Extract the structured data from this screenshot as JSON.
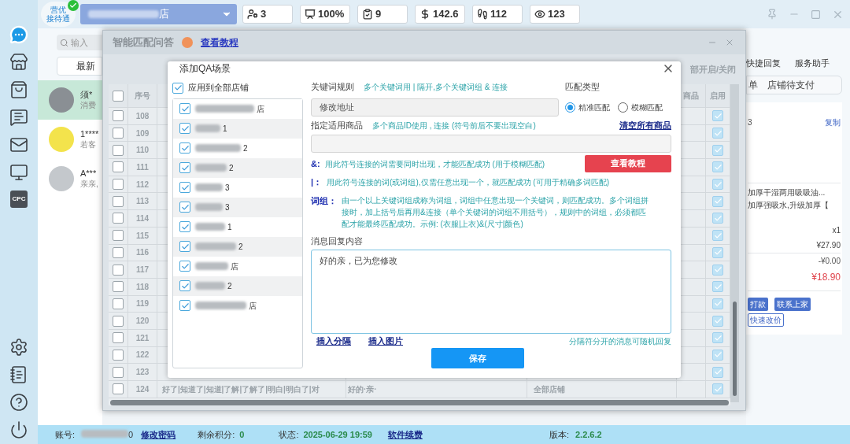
{
  "sidebar": {
    "items": [
      {
        "kind": "chat",
        "selected": true
      },
      {
        "kind": "store",
        "selected": false
      },
      {
        "kind": "bag",
        "selected": false
      },
      {
        "kind": "qa",
        "selected": false
      },
      {
        "kind": "mail",
        "selected": false
      },
      {
        "kind": "monitor",
        "selected": false
      },
      {
        "kind": "cpc",
        "label": "CPC",
        "selected": false
      }
    ],
    "bottom_items": [
      {
        "kind": "settings"
      },
      {
        "kind": "list"
      },
      {
        "kind": "help"
      },
      {
        "kind": "power"
      }
    ]
  },
  "topbar": {
    "logo_lines": [
      "营优",
      "接待通"
    ],
    "verified": true,
    "store_name": "店",
    "stats": [
      {
        "kind": "users",
        "value": "3"
      },
      {
        "kind": "chart",
        "value": "100%"
      },
      {
        "kind": "clipboard",
        "value": "9"
      },
      {
        "kind": "money",
        "value": "142.6"
      },
      {
        "kind": "footprints",
        "value": "112"
      },
      {
        "kind": "views",
        "value": "123"
      }
    ]
  },
  "chat_list": {
    "search_placeholder": "输入",
    "tab": "最新",
    "conversations": [
      {
        "name": "须*",
        "preview": "消费",
        "color": "#8a8f94",
        "selected": true
      },
      {
        "name": "1****",
        "preview": "若客",
        "color": "#f3e34c",
        "selected": false
      },
      {
        "name": "A***",
        "preview": "亲亲,",
        "color": "#c4c8cc",
        "selected": false
      }
    ]
  },
  "right_panel": {
    "tabs": [
      "快捷回复",
      "服务助手"
    ],
    "filters": [
      "单",
      "店铺待支付"
    ],
    "order_code": "3",
    "copy_link": "复制",
    "product_lines": [
      "加厚干湿两用吸吸油...",
      "加厚强吸水,升级加厚【"
    ],
    "quantity": "x1",
    "price": "¥27.90",
    "discount": "-¥0.00",
    "total": "¥18.90",
    "buttons": [
      "打款",
      "联系上家"
    ],
    "reprice_button": "快速改价"
  },
  "qa_window": {
    "title": "智能匹配问答",
    "tutorial_link": "查看教程",
    "toggle_all": "部开启/关闭",
    "columns": [
      "序号",
      "商品",
      "启用"
    ],
    "header_checked": false,
    "rows": [
      {
        "index": "108",
        "checked": false,
        "enabled": true
      },
      {
        "index": "109",
        "checked": false,
        "enabled": true
      },
      {
        "index": "110",
        "checked": false,
        "enabled": true
      },
      {
        "index": "111",
        "checked": false,
        "enabled": true
      },
      {
        "index": "112",
        "checked": false,
        "enabled": true
      },
      {
        "index": "113",
        "checked": false,
        "enabled": true
      },
      {
        "index": "114",
        "checked": false,
        "enabled": true
      },
      {
        "index": "115",
        "checked": false,
        "enabled": true
      },
      {
        "index": "116",
        "checked": false,
        "enabled": true
      },
      {
        "index": "117",
        "checked": false,
        "enabled": true
      },
      {
        "index": "118",
        "checked": false,
        "enabled": true
      },
      {
        "index": "119",
        "checked": false,
        "enabled": true
      },
      {
        "index": "120",
        "checked": false,
        "enabled": true
      },
      {
        "index": "121",
        "checked": false,
        "enabled": true
      },
      {
        "index": "122",
        "checked": false,
        "enabled": true
      },
      {
        "index": "123",
        "checked": false,
        "enabled": true
      },
      {
        "index": "124",
        "checked": false,
        "enabled": true,
        "keywords": "好了|知道了|知道|了解|了解了|明白|明白了|对",
        "reply": "好的·亲·",
        "shops": "全部店铺"
      }
    ]
  },
  "add_qa_dialog": {
    "title": "添加QA场景",
    "apply_all": {
      "label": "应用到全部店铺",
      "checked": true
    },
    "shops": [
      {
        "visible_text": "店",
        "checked": true
      },
      {
        "visible_text": "1",
        "checked": true
      },
      {
        "visible_text": "2",
        "checked": true
      },
      {
        "visible_text": "2",
        "checked": true
      },
      {
        "visible_text": "3",
        "checked": true
      },
      {
        "visible_text": "3",
        "checked": true
      },
      {
        "visible_text": "1",
        "checked": true
      },
      {
        "visible_text": "2",
        "checked": true
      },
      {
        "visible_text": "店",
        "checked": true
      },
      {
        "visible_text": "2",
        "checked": true
      },
      {
        "visible_text": "店",
        "checked": true
      }
    ],
    "keyword_label": "关键词规则",
    "keyword_hint": "多个关键词用 | 隔开,多个关键词组 & 连接",
    "keyword_value": "修改地址",
    "match_type_label": "匹配类型",
    "match_types": [
      {
        "label": "精准匹配",
        "selected": true
      },
      {
        "label": "模糊匹配",
        "selected": false
      }
    ],
    "products_label": "指定适用商品",
    "products_hint": "多个商品ID使用 , 连接 (符号前后不要出现空白)",
    "clear_products_link": "清空所有商品",
    "rules": [
      {
        "symbol": "&:",
        "text": "用此符号连接的词需要同时出现，才能匹配成功 (用于模糊匹配)"
      },
      {
        "symbol": "|：",
        "text": "用此符号连接的词(或词组),仅需任意出现一个，就匹配成功 (可用于精确多词匹配)"
      },
      {
        "symbol": "词组：",
        "text": "由一个以上关键词组成称为词组，词组中任意出现一个关键词，则匹配成功。多个词组拼接时，加上括号后再用&连接（单个关键词的词组不用括号），规则中的词组，必须都匹配才能最终匹配成功。示例: (衣服|上衣)&(尺寸|颜色)"
      }
    ],
    "tutorial_button": "查看教程",
    "reply_label": "消息回复内容",
    "reply_value": "好的亲，已为您修改",
    "links": [
      "插入分隔",
      "插入图片"
    ],
    "reply_hint": "分隔符分开的消息可随机回复",
    "save_button": "保存"
  },
  "status_bar": {
    "account_label": "账号:",
    "account_visible": "0",
    "change_password_link": "修改密码",
    "points_label": "剩余积分:",
    "points_value": "0",
    "state_label": "状态:",
    "state_value": "2025-06-29 19:59",
    "renew_link": "软件续费",
    "version_label": "版本:",
    "version_value": "2.2.6.2"
  }
}
